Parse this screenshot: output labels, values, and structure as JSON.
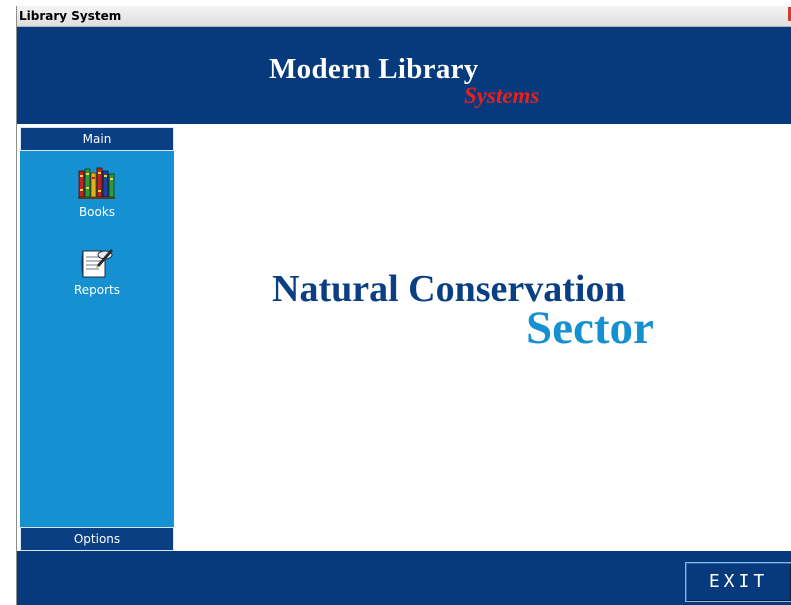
{
  "window": {
    "title": "Library System"
  },
  "header": {
    "brand_main": "Modern Library",
    "brand_sub": "Systems"
  },
  "sidebar": {
    "main_label": "Main",
    "items": [
      {
        "label": "Books",
        "icon": "books-icon"
      },
      {
        "label": "Reports",
        "icon": "report-icon"
      }
    ],
    "options_label": "Options"
  },
  "content": {
    "org_line1": "Natural Conservation",
    "org_line2": "Sector"
  },
  "footer": {
    "exit_label": "EXIT"
  },
  "colors": {
    "navy": "#063a7c",
    "sidebar_blue": "#1591d1",
    "accent_red": "#e8201d"
  }
}
